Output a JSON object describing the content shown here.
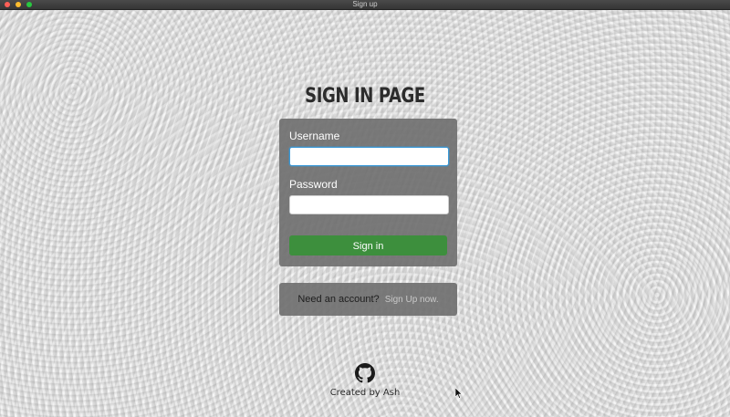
{
  "window": {
    "title": "Sign up"
  },
  "page": {
    "heading": "Sign in page"
  },
  "login_form": {
    "username_label": "Username",
    "username_value": "",
    "username_placeholder": "",
    "password_label": "Password",
    "password_value": "",
    "password_placeholder": "",
    "submit_label": "Sign in"
  },
  "signup": {
    "prompt": "Need an account?",
    "link_label": "Sign Up now."
  },
  "footer": {
    "icon": "github-icon",
    "credit": "Created by Ash"
  },
  "colors": {
    "card_background": "#707070",
    "submit_button": "#3d8f3d",
    "focus_ring": "#3a9ad9",
    "traffic_close": "#ff5f57",
    "traffic_minimize": "#febc2e",
    "traffic_maximize": "#28c840"
  }
}
